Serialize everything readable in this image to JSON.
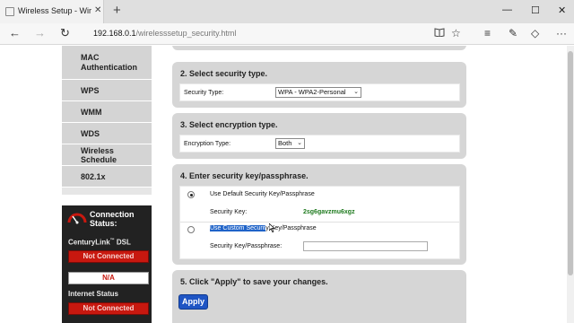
{
  "browser": {
    "tab_title": "Wireless Setup - Wireles",
    "tab_close": "✕",
    "new_tab": "+",
    "minimize": "—",
    "maximize": "☐",
    "close": "✕",
    "back": "←",
    "forward": "→",
    "refresh": "↻",
    "url_host": "192.168.0.1",
    "url_path": "/wirelesssetup_security.html"
  },
  "sidebar": {
    "items": [
      {
        "label": "MAC Authentication"
      },
      {
        "label": "WPS"
      },
      {
        "label": "WMM"
      },
      {
        "label": "WDS"
      },
      {
        "label": "Wireless Schedule"
      },
      {
        "label": "802.1x"
      }
    ]
  },
  "connection": {
    "title": "Connection Status:",
    "dsl_label": "CenturyLink",
    "dsl_suffix": "DSL",
    "dsl_status": "Not Connected",
    "na": "N/A",
    "internet_label": "Internet Status",
    "internet_status": "Not Connected"
  },
  "step2": {
    "title": "2. Select security type.",
    "label": "Security Type:",
    "value": "WPA - WPA2-Personal"
  },
  "step3": {
    "title": "3. Select encryption type.",
    "label": "Encryption Type:",
    "value": "Both"
  },
  "step4": {
    "title": "4. Enter security key/passphrase.",
    "option_default": "Use Default Security Key/Passphrase",
    "security_key_label": "Security Key:",
    "security_key_value": "2sg6gavzmu6xgz",
    "option_custom_highlight": "Use Custom Securit",
    "option_custom_rest": "y Key/Passphrase",
    "custom_key_label": "Security Key/Passphrase:",
    "custom_key_value": ""
  },
  "step5": {
    "title": "5. Click \"Apply\" to save your changes.",
    "apply_label": "Apply"
  },
  "colors": {
    "accent": "#1f55c4",
    "status_red": "#c8180f",
    "key_green": "#1e7a1e"
  }
}
